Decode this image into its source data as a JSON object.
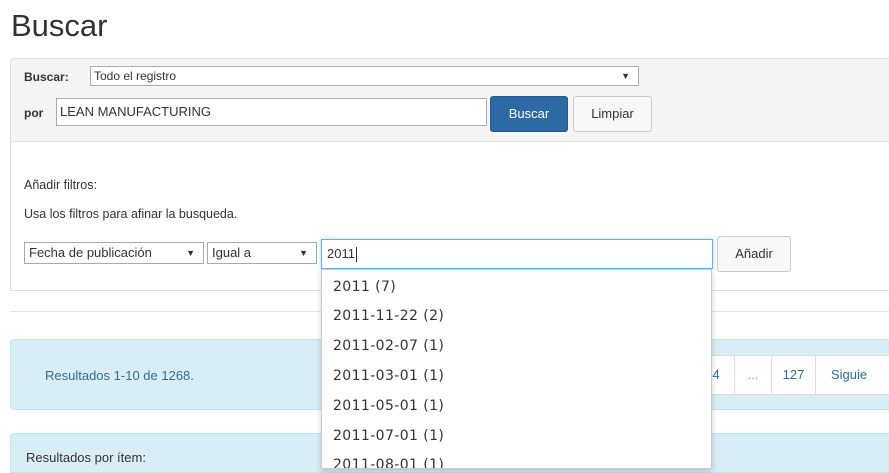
{
  "page": {
    "title": "Buscar"
  },
  "search": {
    "scope_label": "Buscar:",
    "scope_value": "Todo el registro",
    "query_label": "por",
    "query_value": "LEAN MANUFACTURING",
    "submit_label": "Buscar",
    "clear_label": "Limpiar"
  },
  "filters": {
    "heading": "Añadir filtros:",
    "help": "Usa los filtros para afinar la busqueda.",
    "field_value": "Fecha de publicación",
    "operator_value": "Igual a",
    "input_value": "2011",
    "add_label": "Añadir",
    "suggestions": [
      "2011 (7)",
      "2011-11-22 (2)",
      "2011-02-07 (1)",
      "2011-03-01 (1)",
      "2011-05-01 (1)",
      "2011-07-01 (1)",
      "2011-08-01 (1)"
    ]
  },
  "results": {
    "summary": "Resultados 1-10 de 1268.",
    "pager": [
      "4",
      "...",
      "127",
      "Siguie"
    ],
    "per_page_label": "Resultados por ítem:"
  },
  "colors": {
    "primary_button": "#2d6aa5",
    "info_background": "#d9edf7",
    "info_text": "#31708f"
  },
  "icons": {
    "dropdown": "triangle-down-icon"
  }
}
